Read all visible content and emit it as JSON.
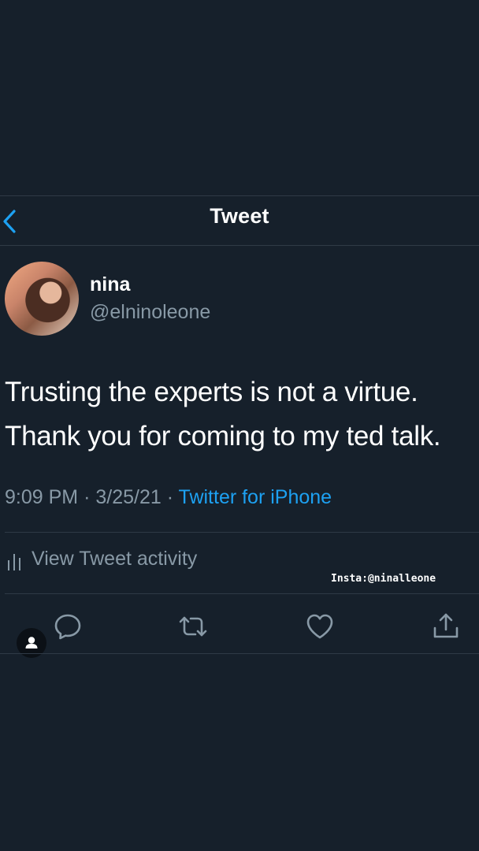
{
  "header": {
    "title": "Tweet",
    "back_icon": "chevron-left-icon",
    "accent_color": "#1da1f2"
  },
  "tweet": {
    "author": {
      "name": "nina",
      "handle": "@elninoleone"
    },
    "text_line_1": "Trusting the experts is not a virtue.",
    "text_line_2": "Thank you for coming to my ted talk.",
    "time": "9:09 PM",
    "date": "3/25/21",
    "separator": "·",
    "source": "Twitter for iPhone"
  },
  "activity": {
    "label": "View Tweet activity",
    "icon": "bar-chart-icon"
  },
  "overlay": {
    "insta_tag": "Insta:@ninalleone"
  },
  "actions": [
    {
      "name": "reply",
      "icon": "reply-icon"
    },
    {
      "name": "retweet",
      "icon": "retweet-icon"
    },
    {
      "name": "like",
      "icon": "heart-icon"
    },
    {
      "name": "share",
      "icon": "share-icon"
    }
  ],
  "colors": {
    "background": "#16202b",
    "secondary_text": "#8899a6",
    "divider": "#2f3a46",
    "link": "#1da1f2"
  }
}
